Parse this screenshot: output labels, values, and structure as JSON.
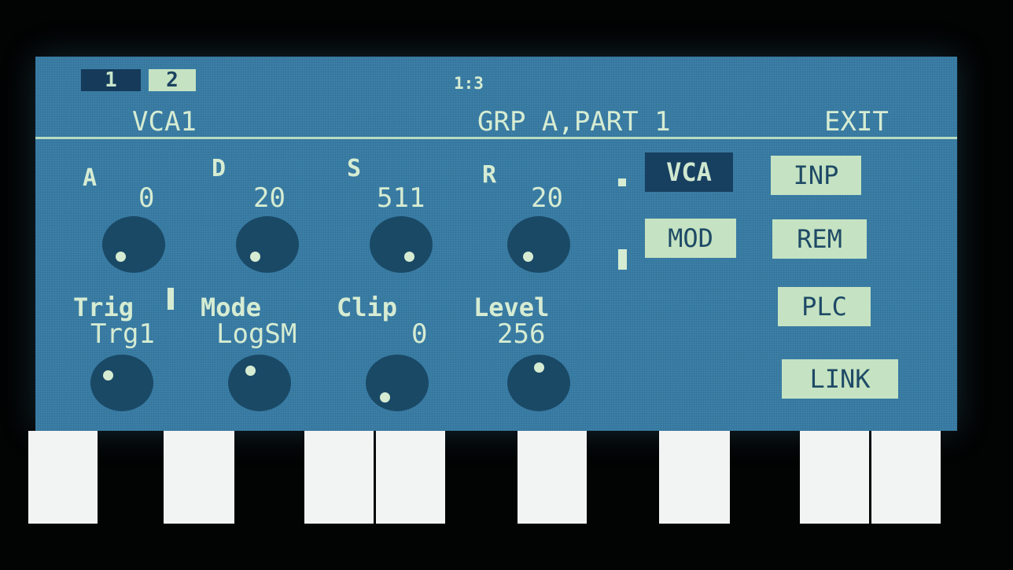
{
  "header": {
    "tab1": "1",
    "tab2": "2",
    "page": "1:3",
    "title": "VCA1",
    "group": "GRP A,PART 1",
    "exit": "EXIT"
  },
  "envelope": {
    "a_label": "A",
    "a_value": "0",
    "d_label": "D",
    "d_value": "20",
    "s_label": "S",
    "s_value": "511",
    "r_label": "R",
    "r_value": "20"
  },
  "params": {
    "trig_label": "Trig",
    "trig_value": "Trg1",
    "mode_label": "Mode",
    "mode_value": "LogSM",
    "clip_label": "Clip",
    "clip_value": "0",
    "level_label": "Level",
    "level_value": "256"
  },
  "buttons": {
    "vca": "VCA",
    "mod": "MOD",
    "inp": "INP",
    "rem": "REM",
    "plc": "PLC",
    "link": "LINK"
  },
  "colors": {
    "screen_bg": "#3b7fa8",
    "text": "#d6ecd2",
    "knob": "#1a4966",
    "button_light": "#c5e3c2",
    "button_dark": "#173f60"
  }
}
